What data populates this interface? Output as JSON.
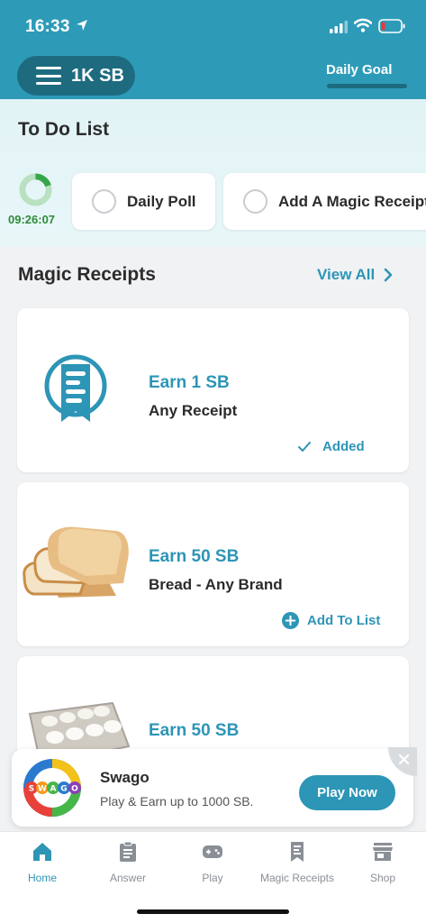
{
  "status_bar": {
    "time": "16:33"
  },
  "header": {
    "balance_label": "1K SB",
    "tab_daily_goal": "Daily Goal"
  },
  "todo": {
    "title": "To Do List",
    "timer": "09:26:07",
    "items": [
      {
        "label": "Daily Poll"
      },
      {
        "label": "Add A Magic Receipt"
      }
    ]
  },
  "magic_receipts": {
    "title": "Magic Receipts",
    "view_all": "View All",
    "offers": [
      {
        "earn": "Earn 1 SB",
        "desc": "Any Receipt",
        "action": "Added",
        "image": "receipt-badge-icon"
      },
      {
        "earn": "Earn 50 SB",
        "desc": "Bread - Any Brand",
        "action": "Add To List",
        "image": "bread-image"
      },
      {
        "earn": "Earn 50 SB",
        "image": "eggs-image"
      }
    ]
  },
  "ad": {
    "logo_text": "SWAGO",
    "title": "Swago",
    "subtitle": "Play & Earn up to 1000 SB.",
    "button": "Play Now"
  },
  "bottom_nav": {
    "items": [
      {
        "label": "Home",
        "icon": "home-icon",
        "active": true
      },
      {
        "label": "Answer",
        "icon": "clipboard-icon"
      },
      {
        "label": "Play",
        "icon": "gamepad-icon"
      },
      {
        "label": "Magic Receipts",
        "icon": "receipt-icon"
      },
      {
        "label": "Shop",
        "icon": "store-icon"
      }
    ]
  },
  "colors": {
    "brand": "#2d9bb8",
    "brand_dark": "#1e6b80",
    "accent_text": "#2d95b6",
    "timer_green": "#2f8a3a"
  }
}
